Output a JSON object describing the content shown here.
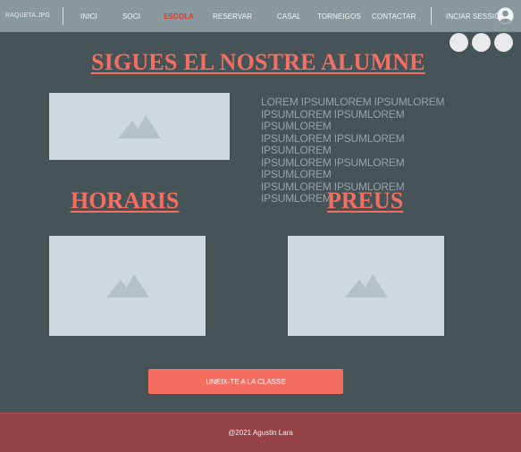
{
  "nav": {
    "logo": "RAQUETA.JPG",
    "items": [
      "INICI",
      "SOCI",
      "ESCOLA",
      "RESERVAR",
      "CASAL",
      "TORNEIGOS",
      "CONTACTAR"
    ],
    "login": "INCIAR SESSIÓ",
    "active_color": "#e0392f"
  },
  "social_icons": [
    "social-circle",
    "social-circle",
    "social-circle"
  ],
  "main": {
    "title": "SIGUES EL NOSTRE ALUMNE",
    "lorem_lines": [
      "LOREM IPSUMLOREM IPSUMLOREM",
      "IPSUMLOREM IPSUMLOREM IPSUMLOREM",
      "IPSUMLOREM IPSUMLOREM IPSUMLOREM",
      "IPSUMLOREM IPSUMLOREM IPSUMLOREM",
      "IPSUMLOREM IPSUMLOREM IPSUMLOREM"
    ],
    "horaris_title": "HORARIS",
    "preus_title": "PREUS",
    "join_button": "UNEIX-TE A LA CLASSE"
  },
  "footer": {
    "text": "@2021 Agustin Lara"
  },
  "colors": {
    "accent": "#f46f62",
    "background": "#465357",
    "footer": "#964348",
    "nav": "#8a999e"
  }
}
